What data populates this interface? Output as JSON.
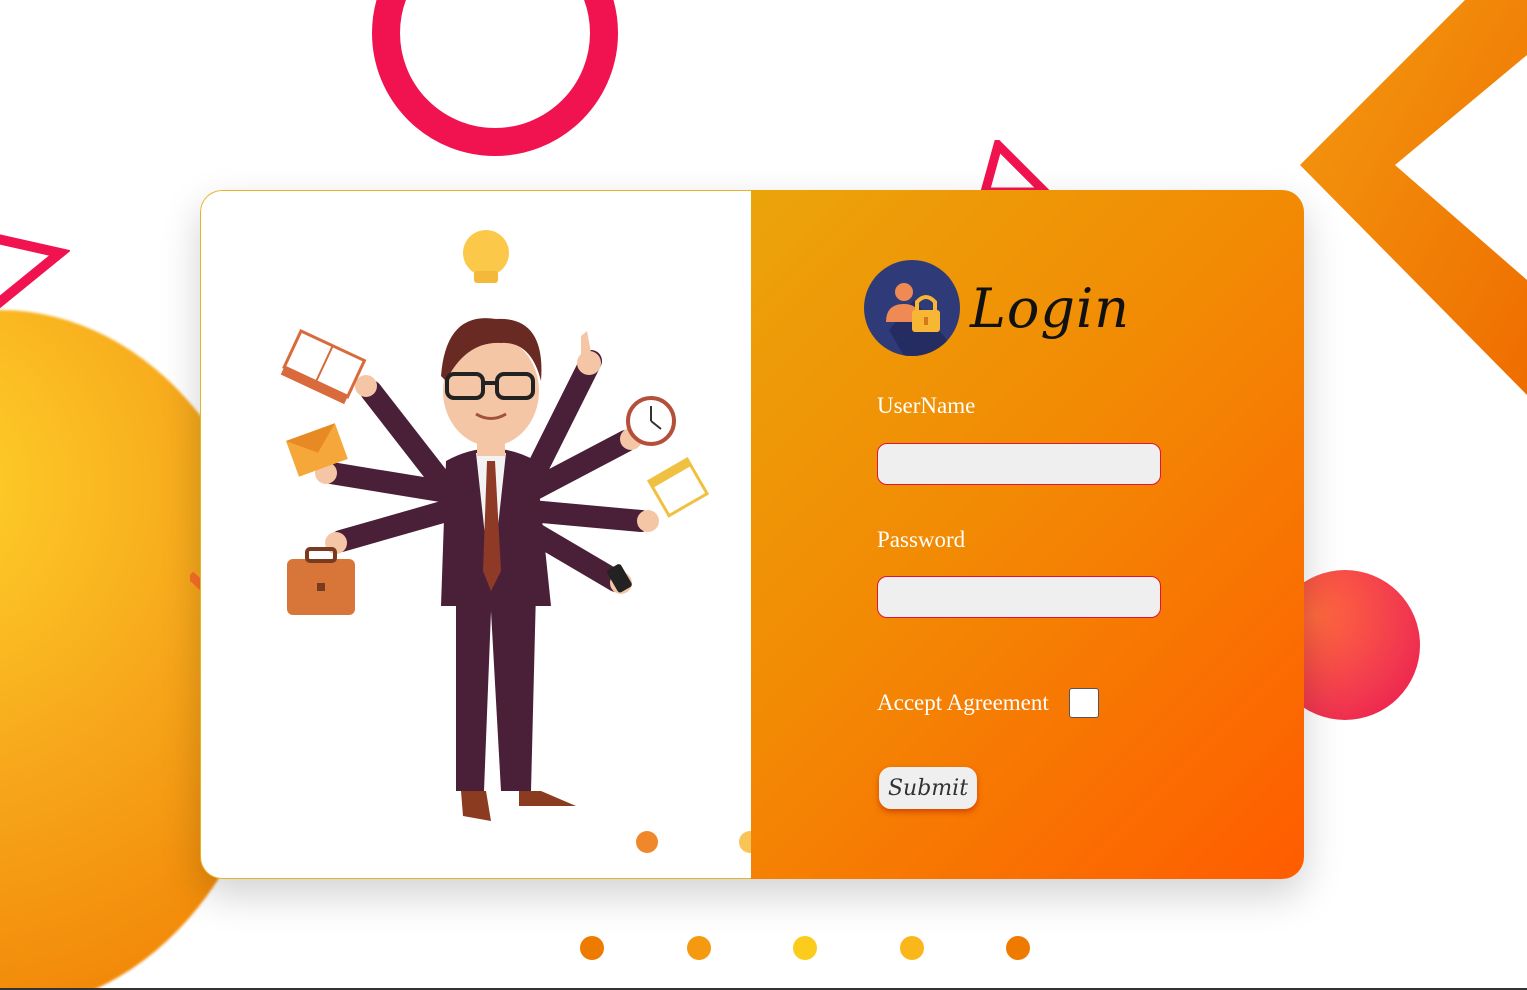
{
  "login": {
    "title": "Login",
    "username_label": "UserName",
    "username_value": "",
    "password_label": "Password",
    "password_value": "",
    "agreement_label": "Accept Agreement",
    "agreement_checked": false,
    "submit_label": "Submit"
  },
  "colors": {
    "panel_gradient_start": "#eba40a",
    "panel_gradient_end": "#ff5c00",
    "input_border": "#e3123a",
    "accent_pink": "#f0134f",
    "accent_orange": "#f07c00",
    "logo_bg": "#2f3a78"
  },
  "icons": {
    "logo": "user-lock-icon",
    "illustration": "multitasking-businessman-illustration"
  }
}
